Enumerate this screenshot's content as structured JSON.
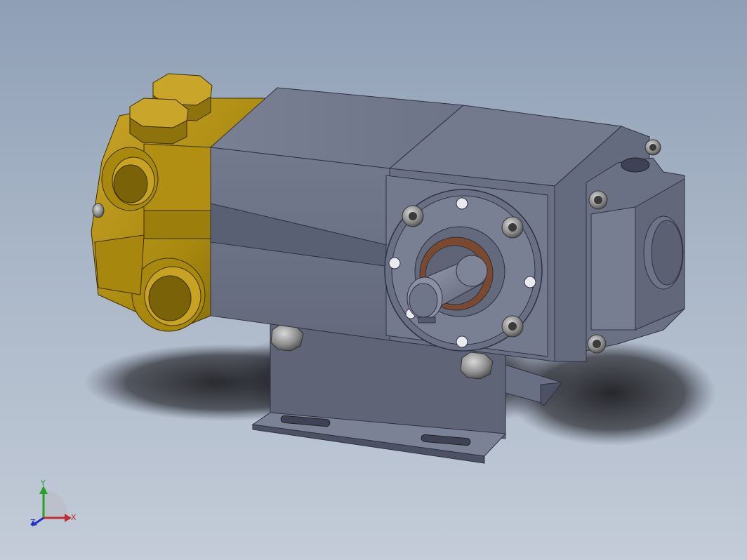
{
  "viewport": {
    "background_top": "#8f9fb6",
    "background_bottom": "#c3ccd8",
    "model_name": "pump-assembly"
  },
  "colors": {
    "brass": "#b08f10",
    "brass_light": "#c9a624",
    "brass_dark": "#6e5808",
    "steel": "#6f7588",
    "steel_light": "#8a90a3",
    "steel_dark": "#4f5466",
    "bolt": "#9a9a9a",
    "bearing": "#7a4a30",
    "shadow": "#1f1f22"
  },
  "triad": {
    "x_label": "X",
    "y_label": "Y",
    "z_label": "Z",
    "x_color": "#c03030",
    "y_color": "#2aa02a",
    "z_color": "#2030c0"
  }
}
